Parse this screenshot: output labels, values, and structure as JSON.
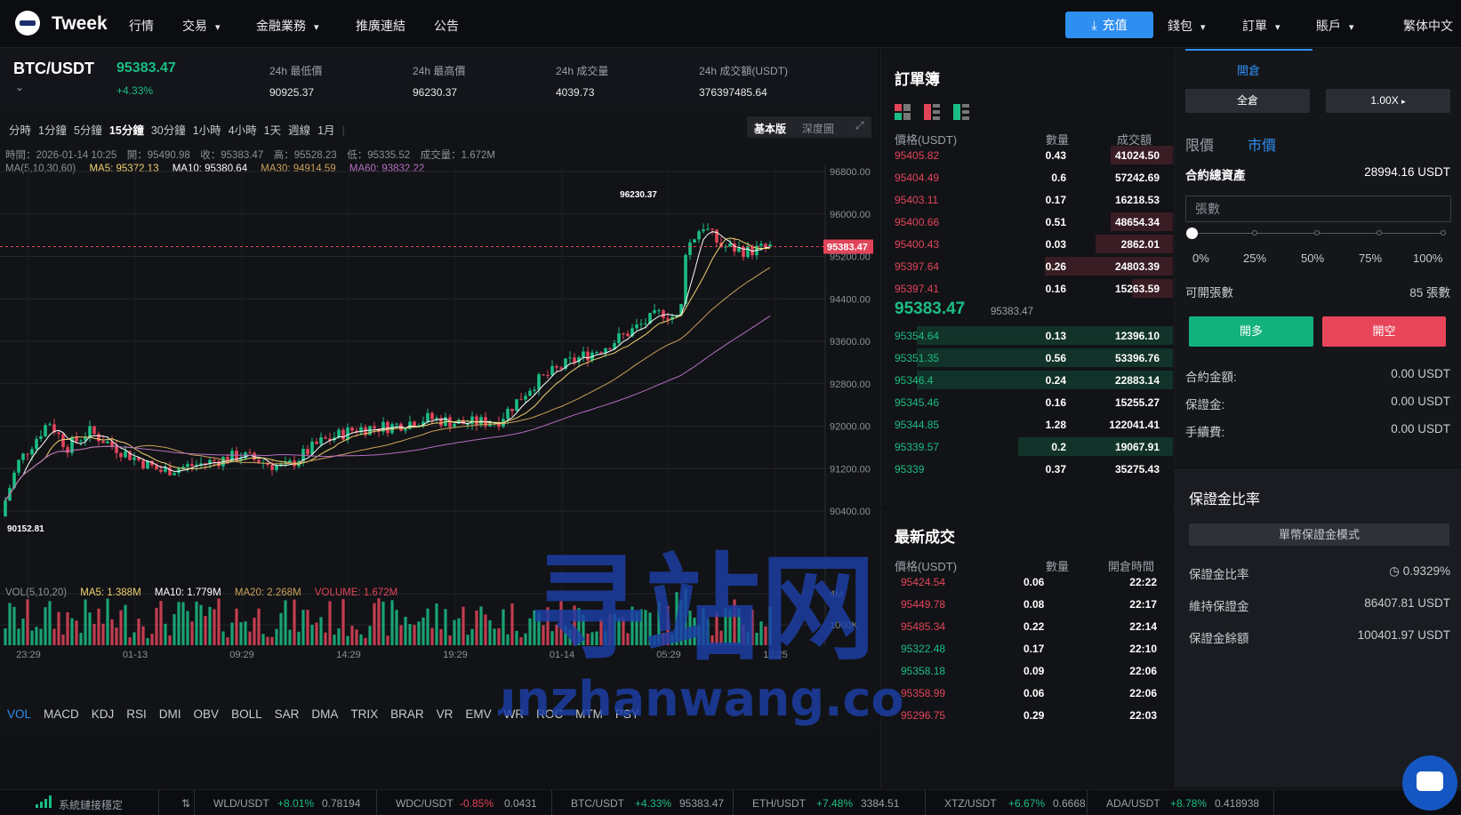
{
  "nav": {
    "brand": "Tweek",
    "items": [
      "行情",
      "交易",
      "金融業務",
      "推廣連結",
      "公告"
    ],
    "recharge": "充值",
    "wallet": "錢包",
    "orders": "訂單",
    "account": "賬戶",
    "language": "繁体中文"
  },
  "ticker": {
    "pair": "BTC/USDT",
    "price": "95383.47",
    "change": "+4.33%",
    "stats": [
      {
        "label": "24h 最低價",
        "value": "90925.37"
      },
      {
        "label": "24h 最高價",
        "value": "96230.37"
      },
      {
        "label": "24h 成交量",
        "value": "4039.73"
      },
      {
        "label": "24h 成交額(USDT)",
        "value": "376397485.64"
      }
    ]
  },
  "chart": {
    "intervals": [
      "分時",
      "1分鐘",
      "5分鐘",
      "15分鐘",
      "30分鐘",
      "1小時",
      "4小時",
      "1天",
      "週線",
      "1月"
    ],
    "active_interval": "15分鐘",
    "modes": [
      "基本版",
      "深度圖"
    ],
    "ohlc": "時間：2026-01-14 10:25　開：95490.98　收：95383.47　高：95528.23　低：95335.52　成交量：1.672M",
    "ma_label": "MA(5,10,30,60)",
    "ma_values": [
      "MA5: 95372.13",
      "MA10: 95380.64",
      "MA30: 94914.59",
      "MA60: 93832.22"
    ],
    "vol_label": "VOL(5,10,20)",
    "vol_values": [
      "MA5: 1.388M",
      "MA10: 1.779M",
      "MA20: 2.268M",
      "VOLUME: 1.672M"
    ],
    "indicators": [
      "VOL",
      "MACD",
      "KDJ",
      "RSI",
      "DMI",
      "OBV",
      "BOLL",
      "SAR",
      "DMA",
      "TRIX",
      "BRAR",
      "VR",
      "EMV",
      "WR",
      "ROC",
      "MTM",
      "PSY"
    ],
    "price_axis": [
      "96800.00",
      "96000.00",
      "95200.00",
      "94400.00",
      "93600.00",
      "92800.00",
      "92000.00",
      "91200.00",
      "90400.00"
    ],
    "vol_axis": [
      "4M",
      "1000K"
    ],
    "time_axis": [
      "23:29",
      "01-13",
      "09:29",
      "14:29",
      "19:29",
      "01-14",
      "05:29",
      "10:25"
    ],
    "high_marker": "96230.37",
    "low_marker": "90152.81",
    "current_price_tag": "95383.47",
    "colors": {
      "up": "#1bbd84",
      "down": "#e2455a",
      "ma5": "#ffffff",
      "ma10": "#f0d270",
      "ma30": "#c9a15a",
      "ma60": "#b46fc1"
    }
  },
  "orderbook": {
    "title": "訂單簿",
    "headers": [
      "價格(USDT)",
      "數量",
      "成交額"
    ],
    "asks": [
      {
        "price": "95405.82",
        "qty": "0.43",
        "total": "41024.50",
        "depth": 0.47
      },
      {
        "price": "95404.49",
        "qty": "0.6",
        "total": "57242.69",
        "depth": 0.0
      },
      {
        "price": "95403.11",
        "qty": "0.17",
        "total": "16218.53",
        "depth": 0.0
      },
      {
        "price": "95400.66",
        "qty": "0.51",
        "total": "48654.34",
        "depth": 0.47
      },
      {
        "price": "95400.43",
        "qty": "0.03",
        "total": "2862.01",
        "depth": 0.58
      },
      {
        "price": "95397.64",
        "qty": "0.26",
        "total": "24803.39",
        "depth": 0.96
      },
      {
        "price": "95397.41",
        "qty": "0.16",
        "total": "15263.59",
        "depth": 0.31
      }
    ],
    "mid_price": "95383.47",
    "mid_sub": "95383.47",
    "bids": [
      {
        "price": "95354.64",
        "qty": "0.13",
        "total": "12396.10",
        "depth": 0.96
      },
      {
        "price": "95351.35",
        "qty": "0.56",
        "total": "53396.76",
        "depth": 0.96
      },
      {
        "price": "95346.4",
        "qty": "0.24",
        "total": "22883.14",
        "depth": 0.96
      },
      {
        "price": "95345.46",
        "qty": "0.16",
        "total": "15255.27",
        "depth": 0.0
      },
      {
        "price": "95344.85",
        "qty": "1.28",
        "total": "122041.41",
        "depth": 0.0
      },
      {
        "price": "95339.57",
        "qty": "0.2",
        "total": "19067.91",
        "depth": 0.58
      },
      {
        "price": "95339",
        "qty": "0.37",
        "total": "35275.43",
        "depth": 0.0
      }
    ]
  },
  "trades": {
    "title": "最新成交",
    "headers": [
      "價格(USDT)",
      "數量",
      "開倉時間"
    ],
    "rows": [
      {
        "price": "95424.54",
        "qty": "0.06",
        "time": "22:22",
        "side": "down"
      },
      {
        "price": "95449.78",
        "qty": "0.08",
        "time": "22:17",
        "side": "down"
      },
      {
        "price": "95485.34",
        "qty": "0.22",
        "time": "22:14",
        "side": "down"
      },
      {
        "price": "95322.48",
        "qty": "0.17",
        "time": "22:10",
        "side": "up"
      },
      {
        "price": "95358.18",
        "qty": "0.09",
        "time": "22:06",
        "side": "up"
      },
      {
        "price": "95358.99",
        "qty": "0.06",
        "time": "22:06",
        "side": "down"
      },
      {
        "price": "95296.75",
        "qty": "0.29",
        "time": "22:03",
        "side": "down"
      }
    ]
  },
  "trade_panel": {
    "tab": "開倉",
    "margin_mode": "全倉",
    "leverage": "1.00X",
    "order_types": [
      "限價",
      "市價"
    ],
    "total_assets_label": "合約總資產",
    "total_assets": "28994.16 USDT",
    "qty_placeholder": "張數",
    "pcts": [
      "0%",
      "25%",
      "50%",
      "75%",
      "100%"
    ],
    "available_label": "可開張數",
    "available": "85 張數",
    "long": "開多",
    "short": "開空",
    "fees": [
      {
        "label": "合約金額:",
        "value": "0.00 USDT"
      },
      {
        "label": "保證金:",
        "value": "0.00 USDT"
      },
      {
        "label": "手續費:",
        "value": "0.00 USDT"
      }
    ]
  },
  "margin": {
    "title": "保證金比率",
    "mode_button": "單幣保證金模式",
    "rows": [
      {
        "label": "保證金比率",
        "value": "0.9329%"
      },
      {
        "label": "維持保證金",
        "value": "86407.81 USDT"
      },
      {
        "label": "保證金餘額",
        "value": "100401.97 USDT"
      }
    ]
  },
  "statusbar": {
    "connection": "系統鏈接穩定",
    "tickers": [
      {
        "pair": "WLD/USDT",
        "change": "+8.01%",
        "price": "0.78194",
        "up": true
      },
      {
        "pair": "WDC/USDT",
        "change": "-0.85%",
        "price": "0.0431",
        "up": false
      },
      {
        "pair": "BTC/USDT",
        "change": "+4.33%",
        "price": "95383.47",
        "up": true
      },
      {
        "pair": "ETH/USDT",
        "change": "+7.48%",
        "price": "3384.51",
        "up": true
      },
      {
        "pair": "XTZ/USDT",
        "change": "+6.67%",
        "price": "0.6668",
        "up": true
      },
      {
        "pair": "ADA/USDT",
        "change": "+8.78%",
        "price": "0.418938",
        "up": true
      }
    ]
  },
  "watermark": {
    "line1": "寻站网",
    "line2": "xunzhanwang.com"
  }
}
